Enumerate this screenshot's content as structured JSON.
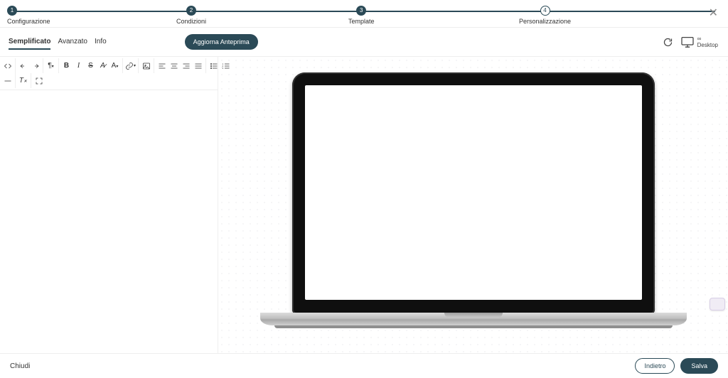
{
  "stepper": {
    "steps": [
      {
        "num": "1",
        "label": "Configurazione"
      },
      {
        "num": "2",
        "label": "Condizioni"
      },
      {
        "num": "3",
        "label": "Template"
      },
      {
        "num": "4",
        "label": "Personalizzazione"
      }
    ]
  },
  "tabs": {
    "simplified": "Semplificato",
    "advanced": "Avanzato",
    "info": "Info"
  },
  "actions": {
    "update_preview": "Aggiorna Anteprima"
  },
  "device": {
    "infinity": "∞",
    "label": "Desktop"
  },
  "toolbar_icons": {
    "code": "code-icon",
    "undo": "undo-icon",
    "redo": "redo-icon",
    "pilcrow": "pilcrow-icon",
    "bold": "B",
    "italic": "I",
    "strike": "S",
    "clear": "clear-format-icon",
    "subscript": "subscript-icon",
    "link": "link-icon",
    "image": "image-icon",
    "align_left": "align-left-icon",
    "align_center": "align-center-icon",
    "align_right": "align-right-icon",
    "align_justify": "align-justify-icon",
    "ul": "ul-icon",
    "ol": "ol-icon",
    "hr": "hr-icon",
    "clear2": "clear-icon",
    "fullscreen": "fullscreen-icon"
  },
  "footer": {
    "close": "Chiudi",
    "back": "Indietro",
    "save": "Salva"
  }
}
